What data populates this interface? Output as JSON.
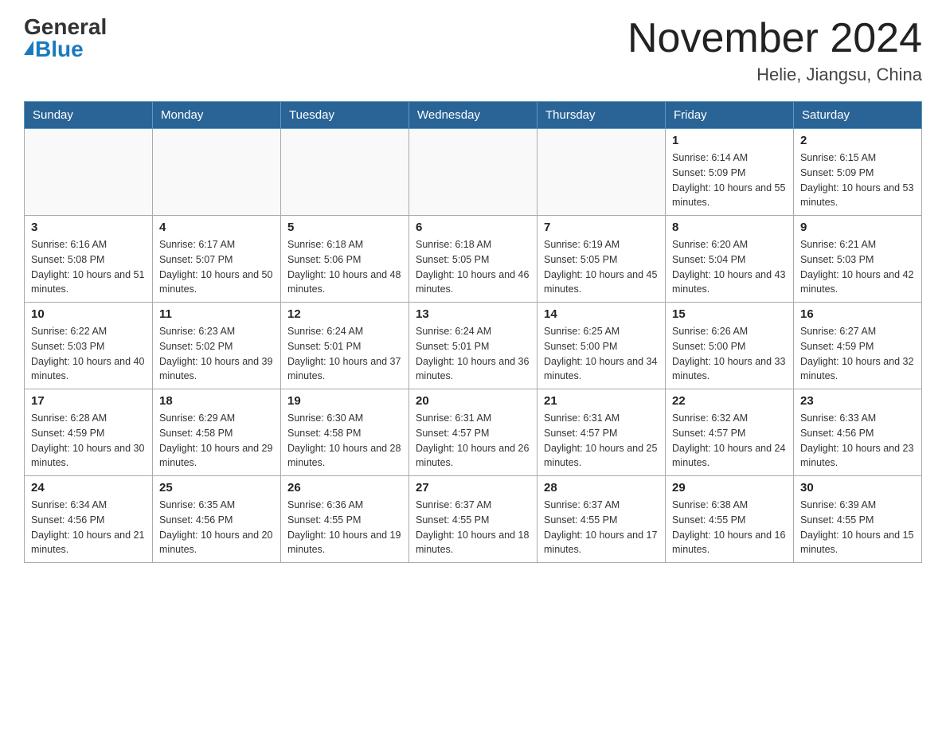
{
  "logo": {
    "general": "General",
    "blue": "Blue"
  },
  "title": "November 2024",
  "subtitle": "Helie, Jiangsu, China",
  "days_of_week": [
    "Sunday",
    "Monday",
    "Tuesday",
    "Wednesday",
    "Thursday",
    "Friday",
    "Saturday"
  ],
  "weeks": [
    [
      {
        "day": "",
        "info": ""
      },
      {
        "day": "",
        "info": ""
      },
      {
        "day": "",
        "info": ""
      },
      {
        "day": "",
        "info": ""
      },
      {
        "day": "",
        "info": ""
      },
      {
        "day": "1",
        "info": "Sunrise: 6:14 AM\nSunset: 5:09 PM\nDaylight: 10 hours and 55 minutes."
      },
      {
        "day": "2",
        "info": "Sunrise: 6:15 AM\nSunset: 5:09 PM\nDaylight: 10 hours and 53 minutes."
      }
    ],
    [
      {
        "day": "3",
        "info": "Sunrise: 6:16 AM\nSunset: 5:08 PM\nDaylight: 10 hours and 51 minutes."
      },
      {
        "day": "4",
        "info": "Sunrise: 6:17 AM\nSunset: 5:07 PM\nDaylight: 10 hours and 50 minutes."
      },
      {
        "day": "5",
        "info": "Sunrise: 6:18 AM\nSunset: 5:06 PM\nDaylight: 10 hours and 48 minutes."
      },
      {
        "day": "6",
        "info": "Sunrise: 6:18 AM\nSunset: 5:05 PM\nDaylight: 10 hours and 46 minutes."
      },
      {
        "day": "7",
        "info": "Sunrise: 6:19 AM\nSunset: 5:05 PM\nDaylight: 10 hours and 45 minutes."
      },
      {
        "day": "8",
        "info": "Sunrise: 6:20 AM\nSunset: 5:04 PM\nDaylight: 10 hours and 43 minutes."
      },
      {
        "day": "9",
        "info": "Sunrise: 6:21 AM\nSunset: 5:03 PM\nDaylight: 10 hours and 42 minutes."
      }
    ],
    [
      {
        "day": "10",
        "info": "Sunrise: 6:22 AM\nSunset: 5:03 PM\nDaylight: 10 hours and 40 minutes."
      },
      {
        "day": "11",
        "info": "Sunrise: 6:23 AM\nSunset: 5:02 PM\nDaylight: 10 hours and 39 minutes."
      },
      {
        "day": "12",
        "info": "Sunrise: 6:24 AM\nSunset: 5:01 PM\nDaylight: 10 hours and 37 minutes."
      },
      {
        "day": "13",
        "info": "Sunrise: 6:24 AM\nSunset: 5:01 PM\nDaylight: 10 hours and 36 minutes."
      },
      {
        "day": "14",
        "info": "Sunrise: 6:25 AM\nSunset: 5:00 PM\nDaylight: 10 hours and 34 minutes."
      },
      {
        "day": "15",
        "info": "Sunrise: 6:26 AM\nSunset: 5:00 PM\nDaylight: 10 hours and 33 minutes."
      },
      {
        "day": "16",
        "info": "Sunrise: 6:27 AM\nSunset: 4:59 PM\nDaylight: 10 hours and 32 minutes."
      }
    ],
    [
      {
        "day": "17",
        "info": "Sunrise: 6:28 AM\nSunset: 4:59 PM\nDaylight: 10 hours and 30 minutes."
      },
      {
        "day": "18",
        "info": "Sunrise: 6:29 AM\nSunset: 4:58 PM\nDaylight: 10 hours and 29 minutes."
      },
      {
        "day": "19",
        "info": "Sunrise: 6:30 AM\nSunset: 4:58 PM\nDaylight: 10 hours and 28 minutes."
      },
      {
        "day": "20",
        "info": "Sunrise: 6:31 AM\nSunset: 4:57 PM\nDaylight: 10 hours and 26 minutes."
      },
      {
        "day": "21",
        "info": "Sunrise: 6:31 AM\nSunset: 4:57 PM\nDaylight: 10 hours and 25 minutes."
      },
      {
        "day": "22",
        "info": "Sunrise: 6:32 AM\nSunset: 4:57 PM\nDaylight: 10 hours and 24 minutes."
      },
      {
        "day": "23",
        "info": "Sunrise: 6:33 AM\nSunset: 4:56 PM\nDaylight: 10 hours and 23 minutes."
      }
    ],
    [
      {
        "day": "24",
        "info": "Sunrise: 6:34 AM\nSunset: 4:56 PM\nDaylight: 10 hours and 21 minutes."
      },
      {
        "day": "25",
        "info": "Sunrise: 6:35 AM\nSunset: 4:56 PM\nDaylight: 10 hours and 20 minutes."
      },
      {
        "day": "26",
        "info": "Sunrise: 6:36 AM\nSunset: 4:55 PM\nDaylight: 10 hours and 19 minutes."
      },
      {
        "day": "27",
        "info": "Sunrise: 6:37 AM\nSunset: 4:55 PM\nDaylight: 10 hours and 18 minutes."
      },
      {
        "day": "28",
        "info": "Sunrise: 6:37 AM\nSunset: 4:55 PM\nDaylight: 10 hours and 17 minutes."
      },
      {
        "day": "29",
        "info": "Sunrise: 6:38 AM\nSunset: 4:55 PM\nDaylight: 10 hours and 16 minutes."
      },
      {
        "day": "30",
        "info": "Sunrise: 6:39 AM\nSunset: 4:55 PM\nDaylight: 10 hours and 15 minutes."
      }
    ]
  ]
}
